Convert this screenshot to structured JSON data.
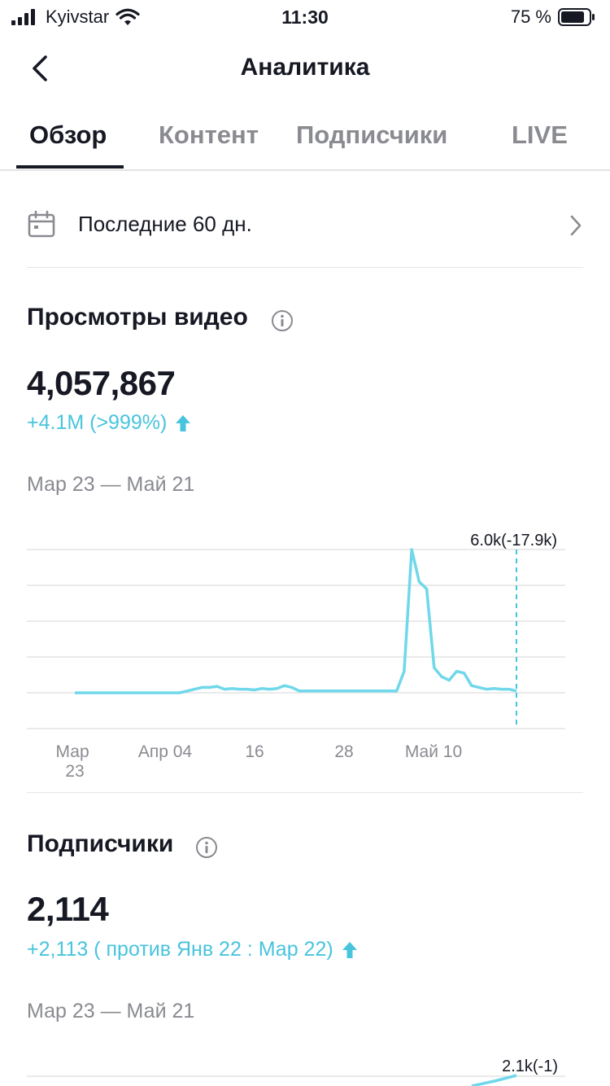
{
  "status_bar": {
    "carrier": "Kyivstar",
    "time": "11:30",
    "battery": "75 %"
  },
  "header": {
    "title": "Аналитика"
  },
  "tabs": [
    {
      "label": "Обзор",
      "active": true
    },
    {
      "label": "Контент",
      "active": false
    },
    {
      "label": "Подписчики",
      "active": false
    },
    {
      "label": "LIVE",
      "active": false
    }
  ],
  "date_filter": {
    "label": "Последние 60 дн."
  },
  "views_section": {
    "title": "Просмотры видео",
    "value": "4,057,867",
    "delta": "+4.1M (>999%)",
    "range": "Мар 23 — Май 21"
  },
  "followers_section": {
    "title": "Подписчики",
    "value": "2,114",
    "delta": "+2,113 ( против Янв 22 : Мар 22)",
    "range": "Мар 23 — Май 21"
  },
  "colors": {
    "accent": "#48c4dd",
    "text": "#161823",
    "muted": "#8a8b91",
    "grid": "#e3e3e4"
  },
  "chart_data": [
    {
      "type": "line",
      "series": [
        {
          "values": [
            0,
            0,
            0,
            0,
            0,
            0,
            0,
            0,
            0,
            0,
            0,
            0,
            0,
            0,
            0,
            0.05,
            0.1,
            0.15,
            0.15,
            0.18,
            0.1,
            0.12,
            0.1,
            0.1,
            0.08,
            0.12,
            0.1,
            0.12,
            0.2,
            0.15,
            0.05,
            0.05,
            0.05,
            0.05,
            0.05,
            0.05,
            0.05,
            0.05,
            0.05,
            0.05,
            0.05,
            0.05,
            0.05,
            0.05,
            0.6,
            4.0,
            3.1,
            2.9,
            0.7,
            0.45,
            0.35,
            0.6,
            0.55,
            0.2,
            0.15,
            0.1,
            0.12,
            0.1,
            0.1,
            0.05
          ]
        }
      ],
      "tooltip": "6.0k(-17.9k)",
      "x_tick_labels": [
        "Мар 23",
        "Апр 04",
        "16",
        "28",
        "Май 10"
      ],
      "grid": true
    },
    {
      "type": "line",
      "series": [
        {
          "values": [
            1.9,
            2.0,
            2.1
          ]
        }
      ],
      "tooltip": "2.1k(-1)",
      "grid": true
    }
  ]
}
